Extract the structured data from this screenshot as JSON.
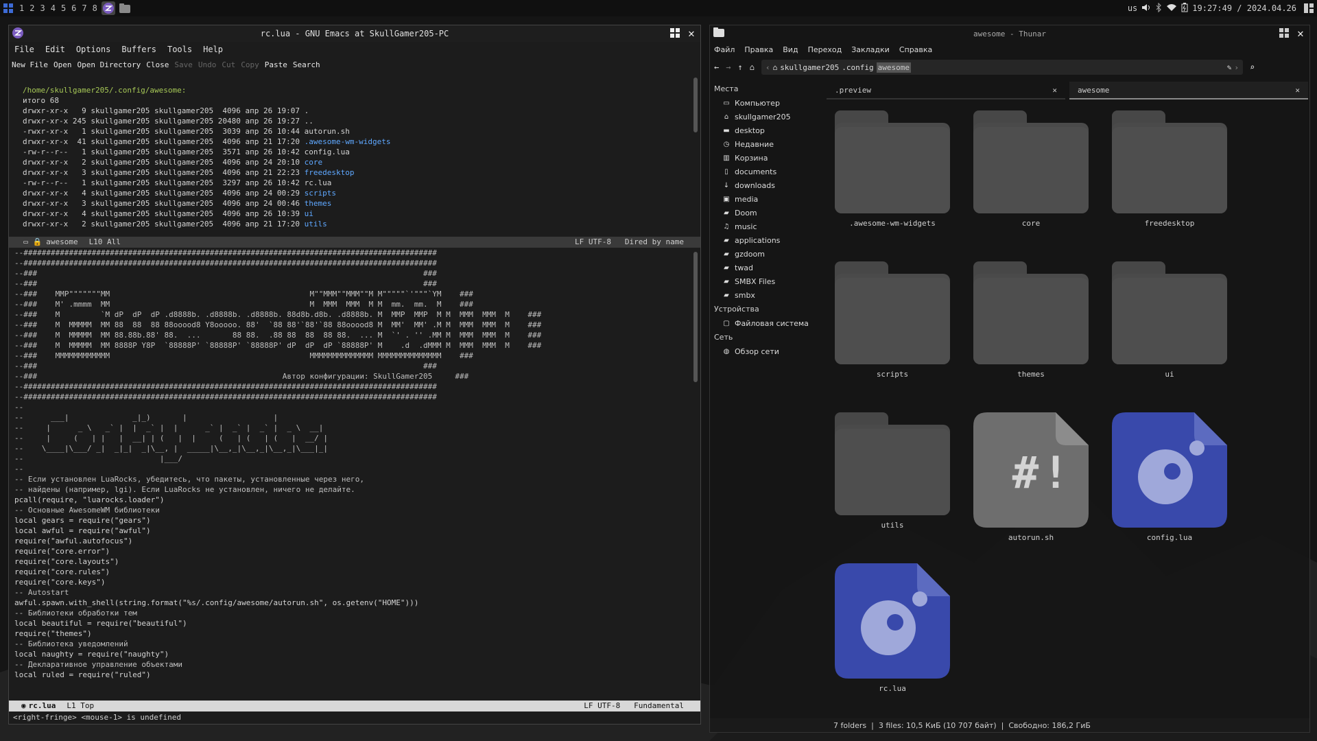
{
  "topbar": {
    "tags": [
      "1",
      "2",
      "3",
      "4",
      "5",
      "6",
      "7",
      "8"
    ],
    "tray": {
      "layout": "us",
      "clock": "19:27:49 / 2024.04.26"
    }
  },
  "emacs": {
    "title": "rc.lua - GNU Emacs at SkullGamer205-PC",
    "menu": [
      "File",
      "Edit",
      "Options",
      "Buffers",
      "Tools",
      "Help"
    ],
    "toolbar": [
      {
        "label": "New File",
        "enabled": true
      },
      {
        "label": "Open",
        "enabled": true
      },
      {
        "label": "Open Directory",
        "enabled": true
      },
      {
        "label": "Close",
        "enabled": true
      },
      {
        "label": "Save",
        "enabled": false
      },
      {
        "label": "Undo",
        "enabled": false
      },
      {
        "label": "Cut",
        "enabled": false
      },
      {
        "label": "Copy",
        "enabled": false
      },
      {
        "label": "Paste",
        "enabled": true
      },
      {
        "label": "Search",
        "enabled": true
      }
    ],
    "dired": {
      "path": "/home/skullgamer205/.config/awesome:",
      "total": "итого 68",
      "rows": [
        {
          "meta": "drwxr-xr-x   9 skullgamer205 skullgamer205  4096 апр 26 19:07 ",
          "name": ".",
          "link": false
        },
        {
          "meta": "drwxr-xr-x 245 skullgamer205 skullgamer205 20480 апр 26 19:27 ",
          "name": "..",
          "link": false
        },
        {
          "meta": "-rwxr-xr-x   1 skullgamer205 skullgamer205  3039 апр 26 10:44 ",
          "name": "autorun.sh",
          "link": false
        },
        {
          "meta": "drwxr-xr-x  41 skullgamer205 skullgamer205  4096 апр 21 17:20 ",
          "name": ".awesome-wm-widgets",
          "link": true
        },
        {
          "meta": "-rw-r--r--   1 skullgamer205 skullgamer205  3571 апр 26 10:42 ",
          "name": "config.lua",
          "link": false
        },
        {
          "meta": "drwxr-xr-x   2 skullgamer205 skullgamer205  4096 апр 24 20:10 ",
          "name": "core",
          "link": true
        },
        {
          "meta": "drwxr-xr-x   3 skullgamer205 skullgamer205  4096 апр 21 22:23 ",
          "name": "freedesktop",
          "link": true
        },
        {
          "meta": "-rw-r--r--   1 skullgamer205 skullgamer205  3297 апр 26 10:42 ",
          "name": "rc.lua",
          "link": false
        },
        {
          "meta": "drwxr-xr-x   4 skullgamer205 skullgamer205  4096 апр 24 00:29 ",
          "name": "scripts",
          "link": true
        },
        {
          "meta": "drwxr-xr-x   3 skullgamer205 skullgamer205  4096 апр 24 00:46 ",
          "name": "themes",
          "link": true
        },
        {
          "meta": "drwxr-xr-x   4 skullgamer205 skullgamer205  4096 апр 26 10:39 ",
          "name": "ui",
          "link": true
        },
        {
          "meta": "drwxr-xr-x   2 skullgamer205 skullgamer205  4096 апр 21 17:20 ",
          "name": "utils",
          "link": true
        }
      ]
    },
    "modeline1": {
      "buffer": "awesome",
      "pos": "L10 All",
      "right": "LF UTF-8   Dired by name"
    },
    "code": [
      "--###########################################################################################",
      "--###########################################################################################",
      "--###                                                                                     ###",
      "--###                                                                                     ###",
      "--###    MMP\"\"\"\"\"\"\"MM                                            M\"\"MMM\"\"MMM\"\"M M\"\"\"\"\"`'\"\"\"`YM    ###",
      "--###    M' .mmmm  MM                                            M  MMM  MMM  M M  mm.  mm.  M    ###",
      "--###    M         `M dP  dP  dP .d8888b. .d8888b. .d8888b. 88d8b.d8b. .d8888b. M  MMP  MMP  M M  MMM  MMM  M    ###",
      "--###    M  MMMMM  MM 88  88  88 88ooood8 Y8ooooo. 88'  `88 88'`88'`88 88ooood8 M  MM'  MM' .M M  MMM  MMM  M    ###",
      "--###    M  MMMMM  MM 88.88b.88' 88.  ...       88 88.  .88 88  88  88 88.  ... M  `' . '' .MM M  MMM  MMM  M    ###",
      "--###    M  MMMMM  MM 8888P Y8P  `88888P' `88888P' `88888P' dP  dP  dP `88888P' M    .d  .dMMM M  MMM  MMM  M    ###",
      "--###    MMMMMMMMMMMM                                            MMMMMMMMMMMMMM MMMMMMMMMMMMMM    ###",
      "--###                                                                                     ###",
      "--###                                                      Автор конфигурации: SkullGamer205     ###",
      "--###########################################################################################",
      "--###########################################################################################",
      "--",
      "--      ___|              _|_)       |                   |",
      "--     |      _ \\   _` |  |  _` |  |      _` |  _` |  _` |  _ \\  __|",
      "--     |     (   | |   |  __| | (   |  |     (   | (   | (   |  __/ |",
      "--    \\____|\\___/ _|  _|_|  _|\\__, |  _____|\\__,_|\\__,_|\\__,_|\\___|_|",
      "--                              |___/",
      "--",
      "-- Если установлен LuaRocks, убедитесь, что пакеты, установленные через него,",
      "-- найдены (например, lgi). Если LuaRocks не установлен, ничего не делайте.",
      "pcall(require, \"luarocks.loader\")",
      "",
      "-- Основные AwesomeWM библиотеки",
      "local gears = require(\"gears\")",
      "local awful = require(\"awful\")",
      "require(\"awful.autofocus\")",
      "require(\"core.error\")",
      "require(\"core.layouts\")",
      "require(\"core.rules\")",
      "require(\"core.keys\")",
      "",
      "-- Autostart",
      "awful.spawn.with_shell(string.format(\"%s/.config/awesome/autorun.sh\", os.getenv(\"HOME\")))",
      "-- Библиотеки обработки тем",
      "local beautiful = require(\"beautiful\")",
      "require(\"themes\")",
      "-- Библиотека уведомлений",
      "local naughty = require(\"naughty\")",
      "-- Декларативное управление объектами",
      "local ruled = require(\"ruled\")"
    ],
    "modeline2": {
      "buffer": "rc.lua",
      "pos": "L1 Top",
      "right": "LF UTF-8   Fundamental"
    },
    "echo": "<right-fringe> <mouse-1> is undefined"
  },
  "thunar": {
    "title": "awesome - Thunar",
    "menu": [
      "Файл",
      "Правка",
      "Вид",
      "Переход",
      "Закладки",
      "Справка"
    ],
    "path": [
      "skullgamer205",
      ".config",
      "awesome"
    ],
    "sidebar": {
      "places_header": "Места",
      "places": [
        {
          "icon": "computer-icon",
          "label": "Компьютер"
        },
        {
          "icon": "home-icon",
          "label": "skullgamer205"
        },
        {
          "icon": "desktop-icon",
          "label": "desktop"
        },
        {
          "icon": "recent-icon",
          "label": "Недавние"
        },
        {
          "icon": "trash-icon",
          "label": "Корзина"
        },
        {
          "icon": "documents-icon",
          "label": "documents"
        },
        {
          "icon": "downloads-icon",
          "label": "downloads"
        },
        {
          "icon": "media-icon",
          "label": "media"
        },
        {
          "icon": "folder-icon",
          "label": "Doom"
        },
        {
          "icon": "music-icon",
          "label": "music"
        },
        {
          "icon": "folder-icon",
          "label": "applications"
        },
        {
          "icon": "folder-icon",
          "label": "gzdoom"
        },
        {
          "icon": "folder-icon",
          "label": "twad"
        },
        {
          "icon": "folder-icon",
          "label": "SMBX Files"
        },
        {
          "icon": "folder-icon",
          "label": "smbx"
        }
      ],
      "devices_header": "Устройства",
      "devices": [
        {
          "icon": "drive-icon",
          "label": "Файловая система"
        }
      ],
      "network_header": "Сеть",
      "network": [
        {
          "icon": "network-icon",
          "label": "Обзор сети"
        }
      ]
    },
    "tabs": [
      {
        "label": ".preview",
        "active": false
      },
      {
        "label": "awesome",
        "active": true
      }
    ],
    "items": [
      {
        "name": ".awesome-wm-widgets",
        "kind": "folder"
      },
      {
        "name": "core",
        "kind": "folder"
      },
      {
        "name": "freedesktop",
        "kind": "folder"
      },
      {
        "name": "scripts",
        "kind": "folder"
      },
      {
        "name": "themes",
        "kind": "folder"
      },
      {
        "name": "ui",
        "kind": "folder"
      },
      {
        "name": "utils",
        "kind": "folder"
      },
      {
        "name": "autorun.sh",
        "kind": "script"
      },
      {
        "name": "config.lua",
        "kind": "lua"
      },
      {
        "name": "rc.lua",
        "kind": "lua"
      }
    ],
    "status": "7 folders  |  3 files: 10,5 КиБ (10 707 байт)  |  Свободно: 186,2 ГиБ"
  },
  "colors": {
    "accent": "#3f51b5",
    "lua_icon": "#3949ab",
    "folder": "#4a4a4a"
  }
}
